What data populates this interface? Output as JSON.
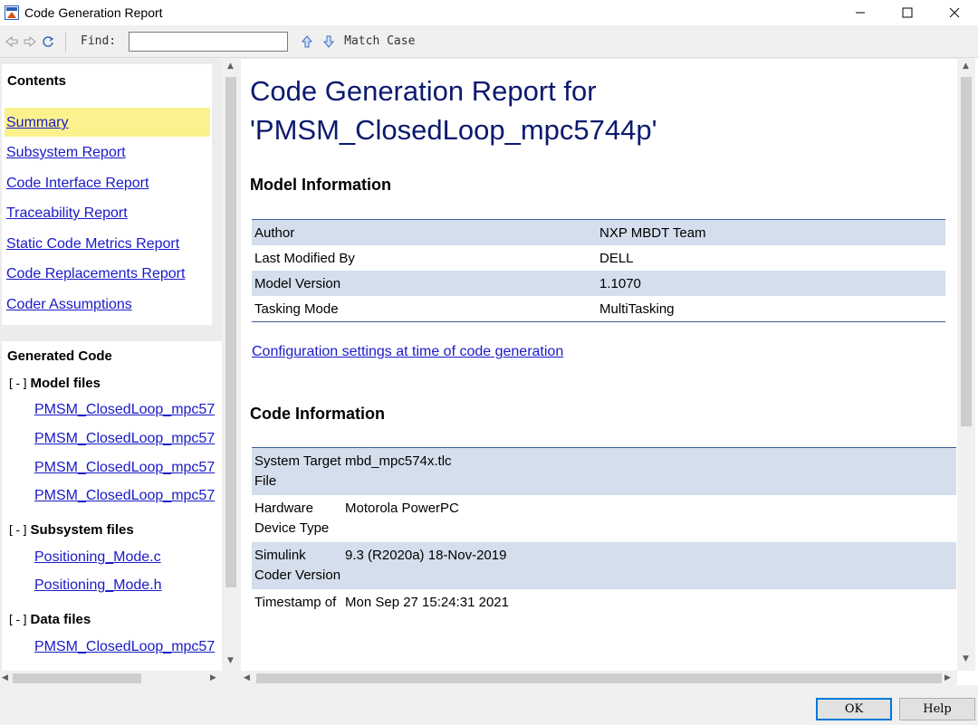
{
  "window": {
    "title": "Code Generation Report"
  },
  "toolbar": {
    "find_label": "Find:",
    "find_value": "",
    "match_case_label": "Match Case"
  },
  "contents": {
    "title": "Contents",
    "items": [
      {
        "label": "Summary",
        "active": true
      },
      {
        "label": "Subsystem Report"
      },
      {
        "label": "Code Interface Report"
      },
      {
        "label": "Traceability Report"
      },
      {
        "label": "Static Code Metrics Report"
      },
      {
        "label": "Code Replacements Report"
      },
      {
        "label": "Coder Assumptions"
      }
    ]
  },
  "generated_code": {
    "title": "Generated Code",
    "toggle": "[-]",
    "groups": [
      {
        "title": "Model files",
        "files": [
          "PMSM_ClosedLoop_mpc57",
          "PMSM_ClosedLoop_mpc57",
          "PMSM_ClosedLoop_mpc57",
          "PMSM_ClosedLoop_mpc57"
        ]
      },
      {
        "title": "Subsystem files",
        "files": [
          "Positioning_Mode.c",
          "Positioning_Mode.h"
        ]
      },
      {
        "title": "Data files",
        "files": [
          "PMSM_ClosedLoop_mpc57"
        ]
      }
    ]
  },
  "report": {
    "title_line1": "Code Generation Report for",
    "title_line2": "'PMSM_ClosedLoop_mpc5744p'",
    "model_info_heading": "Model Information",
    "model_info": [
      {
        "key": "Author",
        "value": "NXP MBDT Team"
      },
      {
        "key": "Last Modified By",
        "value": "DELL"
      },
      {
        "key": "Model Version",
        "value": "1.1070"
      },
      {
        "key": "Tasking Mode",
        "value": "MultiTasking"
      }
    ],
    "config_link": "Configuration settings at time of code generation",
    "code_info_heading": "Code Information",
    "code_info": [
      {
        "key": "System Target File",
        "value": "mbd_mpc574x.tlc"
      },
      {
        "key": "Hardware Device Type",
        "value": "Motorola PowerPC"
      },
      {
        "key": "Simulink Coder Version",
        "value": "9.3 (R2020a) 18-Nov-2019"
      },
      {
        "key": "Timestamp of",
        "value": "Mon Sep 27 15:24:31 2021"
      }
    ]
  },
  "buttons": {
    "ok": "OK",
    "help": "Help"
  }
}
